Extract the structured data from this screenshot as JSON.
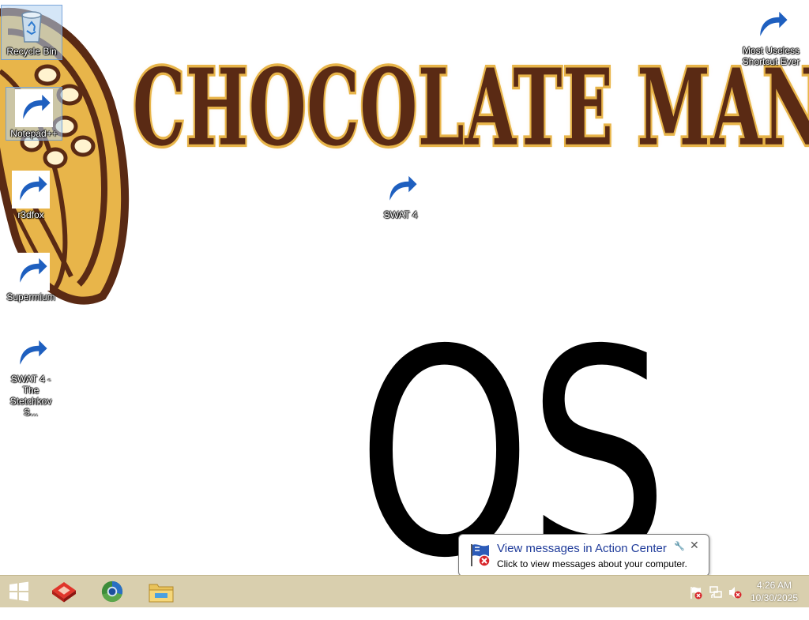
{
  "wallpaper": {
    "brand_title": "CHOCOLATE MAN",
    "os_text": "OS",
    "colors": {
      "chocolate": "#5a2a14",
      "gold": "#e8b54a"
    }
  },
  "desktop_icons": [
    {
      "label": "Recycle Bin",
      "icon": "recycle-bin-icon"
    },
    {
      "label": "Notepad++",
      "icon": "notepad-plus-plus-icon"
    },
    {
      "label": "r3dfox",
      "icon": "r3dfox-browser-icon"
    },
    {
      "label": "Supermium",
      "icon": "supermium-browser-icon"
    },
    {
      "label": "SWAT 4 - The Stetchkov S...",
      "icon": "swat4-game-icon"
    },
    {
      "label": "SWAT 4",
      "icon": "swat4-game-icon"
    },
    {
      "label": "Most Useless Shortcut Ever",
      "icon": "help-question-icon"
    }
  ],
  "notification": {
    "title": "View messages in Action Center",
    "text": "Click to view messages about your computer.",
    "icon": "action-center-flag-icon"
  },
  "taskbar": {
    "pinned": [
      {
        "name": "r3dfox",
        "icon": "r3dfox-browser-icon"
      },
      {
        "name": "Supermium",
        "icon": "supermium-browser-icon"
      },
      {
        "name": "File Explorer",
        "icon": "file-explorer-icon"
      }
    ],
    "tray": [
      "action-center-flag-icon",
      "network-icon",
      "volume-muted-icon"
    ],
    "clock": {
      "time": "4:26 AM",
      "date": "10/30/2025"
    },
    "color": "#d9cfae"
  }
}
